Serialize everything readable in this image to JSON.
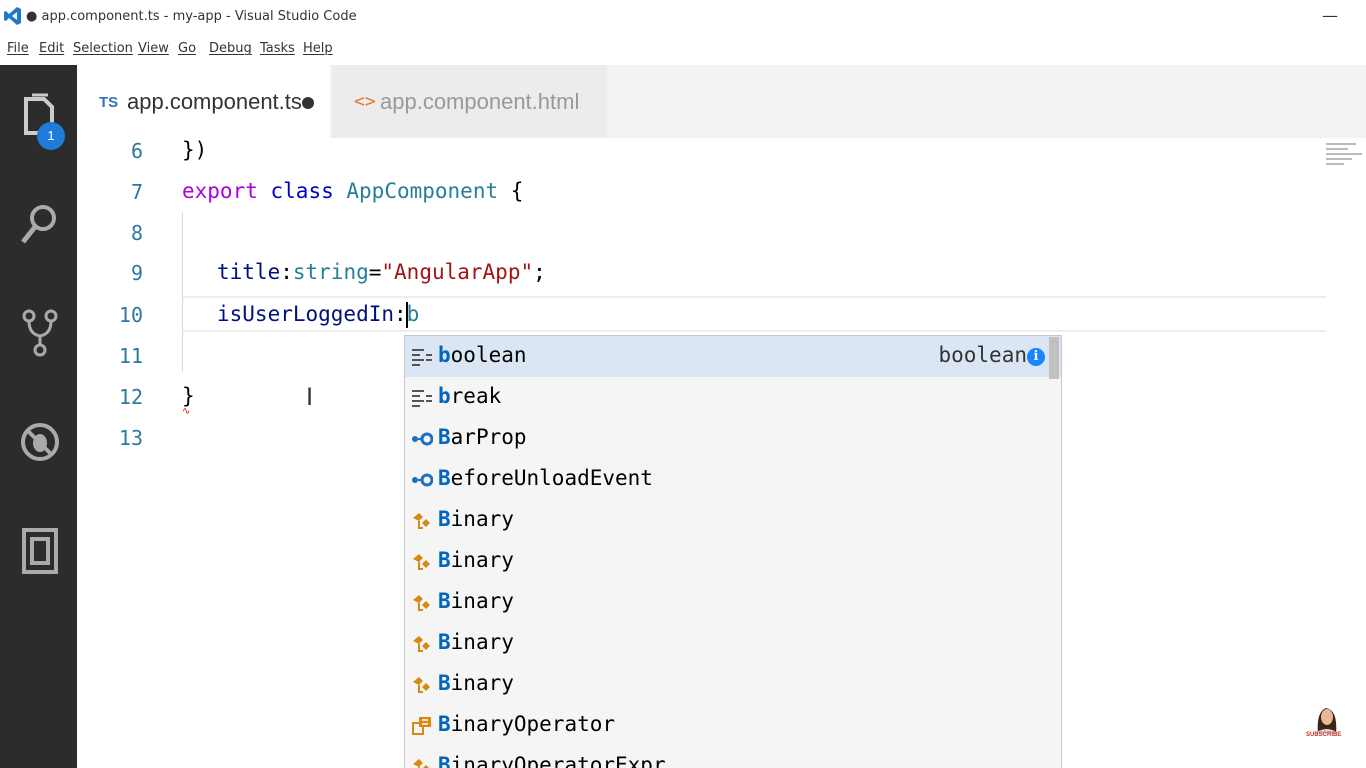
{
  "window": {
    "title": "● app.component.ts - my-app - Visual Studio Code",
    "minimize": "—"
  },
  "menu": [
    "File",
    "Edit",
    "Selection",
    "View",
    "Go",
    "Debug",
    "Tasks",
    "Help"
  ],
  "activity_bar": {
    "explorer_badge": "1"
  },
  "tabs": [
    {
      "icon_text": "TS",
      "label": "app.component.ts",
      "dirty": true,
      "active": true
    },
    {
      "icon_text": "<>",
      "label": "app.component.html",
      "dirty": false,
      "active": false
    }
  ],
  "editor": {
    "lines": [
      {
        "num": "6",
        "text": "})"
      },
      {
        "num": "7",
        "kw": "export",
        "kw2": "class",
        "cls": "AppComponent",
        "rest": " {"
      },
      {
        "num": "8",
        "text": ""
      },
      {
        "num": "9",
        "prop": "title",
        "sep": ":",
        "type": "string",
        "eq": "=",
        "str": "\"AngularApp\"",
        "end": ";"
      },
      {
        "num": "10",
        "prop": "isUserLoggedIn",
        "sep": ":",
        "typed": "b"
      },
      {
        "num": "11",
        "text": ""
      },
      {
        "num": "12",
        "text": "}"
      },
      {
        "num": "13",
        "text": ""
      }
    ]
  },
  "suggestions": [
    {
      "match": "b",
      "rest": "oolean",
      "icon": "keyword-icon",
      "detail": "boolean",
      "selected": true
    },
    {
      "match": "b",
      "rest": "reak",
      "icon": "keyword-icon"
    },
    {
      "match": "B",
      "rest": "arProp",
      "icon": "interface-icon"
    },
    {
      "match": "B",
      "rest": "eforeUnloadEvent",
      "icon": "interface-icon"
    },
    {
      "match": "B",
      "rest": "inary",
      "icon": "class-icon"
    },
    {
      "match": "B",
      "rest": "inary",
      "icon": "class-icon"
    },
    {
      "match": "B",
      "rest": "inary",
      "icon": "class-icon"
    },
    {
      "match": "B",
      "rest": "inary",
      "icon": "class-icon"
    },
    {
      "match": "B",
      "rest": "inary",
      "icon": "class-icon"
    },
    {
      "match": "B",
      "rest": "inaryOperator",
      "icon": "enum-icon"
    },
    {
      "match": "B",
      "rest": "inaryOperatorExpr",
      "icon": "class-icon"
    }
  ],
  "avatar": {
    "caption": "SUBSCRIBE"
  },
  "colors": {
    "activity_bg": "#2c2c2c",
    "badge": "#1e7bd8",
    "selected_row": "#dbe6f5",
    "match": "#0066bf",
    "keyword": "#af00db",
    "string": "#a31515"
  }
}
